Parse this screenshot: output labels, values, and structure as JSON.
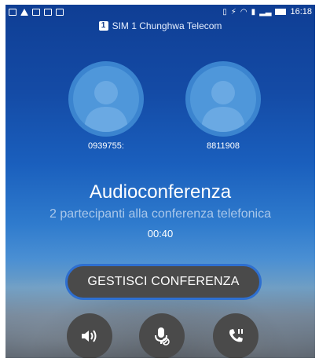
{
  "status_bar": {
    "time": "16:18"
  },
  "sim": {
    "badge": "1",
    "label": "SIM 1  Chunghwa Telecom"
  },
  "participants": [
    {
      "number": "0939755:"
    },
    {
      "number": "8811908"
    }
  ],
  "call": {
    "title": "Audioconferenza",
    "subtitle": "2 partecipanti alla conferenza telefonica",
    "timer": "00:40"
  },
  "manage_button": {
    "label": "GESTISCI CONFERENZA"
  },
  "controls": [
    {
      "icon": "speaker-icon"
    },
    {
      "icon": "mute-mic-icon"
    },
    {
      "icon": "hold-call-icon"
    }
  ],
  "colors": {
    "background_top": "#0f3e94",
    "avatar_fill": "#4f97da",
    "button_bg": "#4a4a4a",
    "button_border": "#2e6fd0"
  }
}
